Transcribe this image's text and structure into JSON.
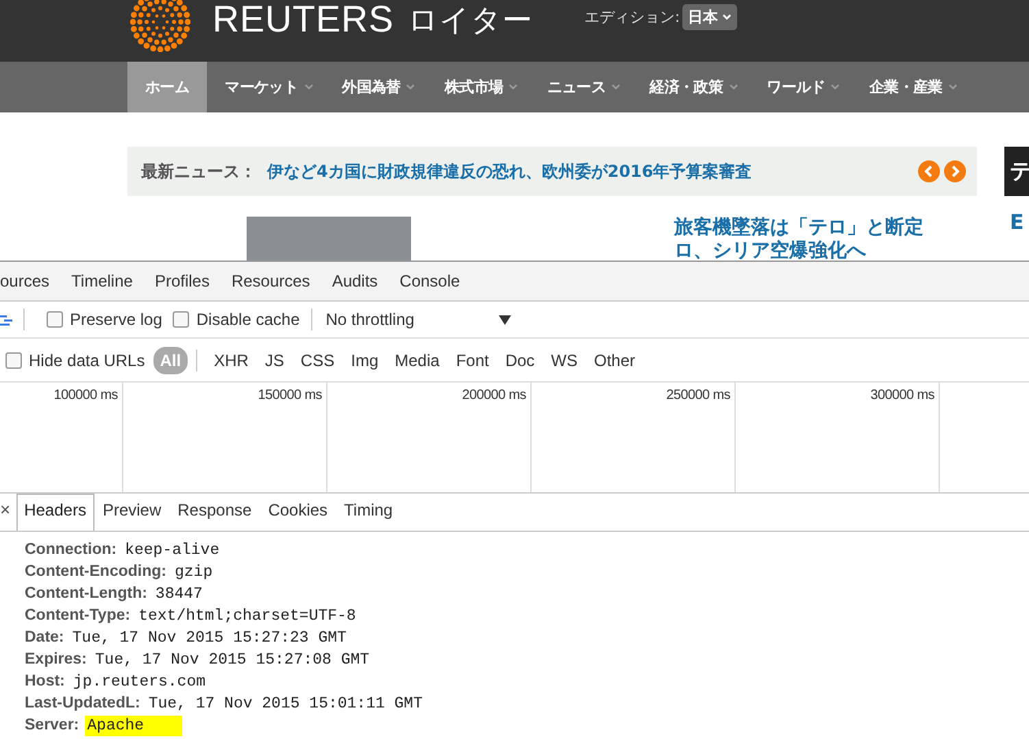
{
  "site": {
    "brand": "REUTERS",
    "brand_jp": "ロイター",
    "edition_label": "エディション:",
    "edition_value": "日本",
    "nav": [
      {
        "label": "ホーム",
        "selected": true,
        "has_menu": false
      },
      {
        "label": "マーケット",
        "selected": false,
        "has_menu": true
      },
      {
        "label": "外国為替",
        "selected": false,
        "has_menu": true
      },
      {
        "label": "株式市場",
        "selected": false,
        "has_menu": true
      },
      {
        "label": "ニュース",
        "selected": false,
        "has_menu": true
      },
      {
        "label": "経済・政策",
        "selected": false,
        "has_menu": true
      },
      {
        "label": "ワールド",
        "selected": false,
        "has_menu": true
      },
      {
        "label": "企業・産業",
        "selected": false,
        "has_menu": true
      }
    ],
    "ticker": {
      "label": "最新ニュース：",
      "headline": "伊など4カ国に財政規律違反の恐れ、欧州委が2016年予算案審査"
    },
    "story_lines": [
      "旅客機墜落は「テロ」と断定",
      "ロ、シリア空爆強化へ"
    ],
    "side_tab": "テ",
    "side_link": "E"
  },
  "devtools": {
    "panel_tabs": [
      {
        "label": "ources",
        "selected": false
      },
      {
        "label": "Timeline",
        "selected": false
      },
      {
        "label": "Profiles",
        "selected": false
      },
      {
        "label": "Resources",
        "selected": false
      },
      {
        "label": "Audits",
        "selected": false
      },
      {
        "label": "Console",
        "selected": false
      }
    ],
    "options": [
      {
        "label": "Preserve log",
        "checked": false
      },
      {
        "label": "Disable cache",
        "checked": false
      }
    ],
    "throttling": "No throttling",
    "hide_data_urls": {
      "label": "Hide data URLs",
      "checked": false
    },
    "types": [
      {
        "label": "All",
        "selected": true
      },
      {
        "label": "XHR",
        "selected": false
      },
      {
        "label": "JS",
        "selected": false
      },
      {
        "label": "CSS",
        "selected": false
      },
      {
        "label": "Img",
        "selected": false
      },
      {
        "label": "Media",
        "selected": false
      },
      {
        "label": "Font",
        "selected": false
      },
      {
        "label": "Doc",
        "selected": false
      },
      {
        "label": "WS",
        "selected": false
      },
      {
        "label": "Other",
        "selected": false
      }
    ],
    "ticks": [
      "100000 ms",
      "150000 ms",
      "200000 ms",
      "250000 ms",
      "300000 ms"
    ],
    "close": "×",
    "detail_tabs": [
      {
        "label": "Headers",
        "selected": true
      },
      {
        "label": "Preview",
        "selected": false
      },
      {
        "label": "Response",
        "selected": false
      },
      {
        "label": "Cookies",
        "selected": false
      },
      {
        "label": "Timing",
        "selected": false
      }
    ],
    "headers": [
      {
        "name": "Connection:",
        "value": "keep-alive",
        "highlighted": false
      },
      {
        "name": "Content-Encoding:",
        "value": "gzip",
        "highlighted": false
      },
      {
        "name": "Content-Length:",
        "value": "38447",
        "highlighted": false
      },
      {
        "name": "Content-Type:",
        "value": "text/html;charset=UTF-8",
        "highlighted": false
      },
      {
        "name": "Date:",
        "value": "Tue, 17 Nov 2015 15:27:23 GMT",
        "highlighted": false
      },
      {
        "name": "Expires:",
        "value": "Tue, 17 Nov 2015 15:27:08 GMT",
        "highlighted": false
      },
      {
        "name": "Host:",
        "value": "jp.reuters.com",
        "highlighted": false
      },
      {
        "name": "Last-UpdatedL:",
        "value": "Tue, 17 Nov 2015 15:01:11 GMT",
        "highlighted": false
      },
      {
        "name": "Server:",
        "value": "Apache",
        "highlighted": true
      }
    ]
  }
}
